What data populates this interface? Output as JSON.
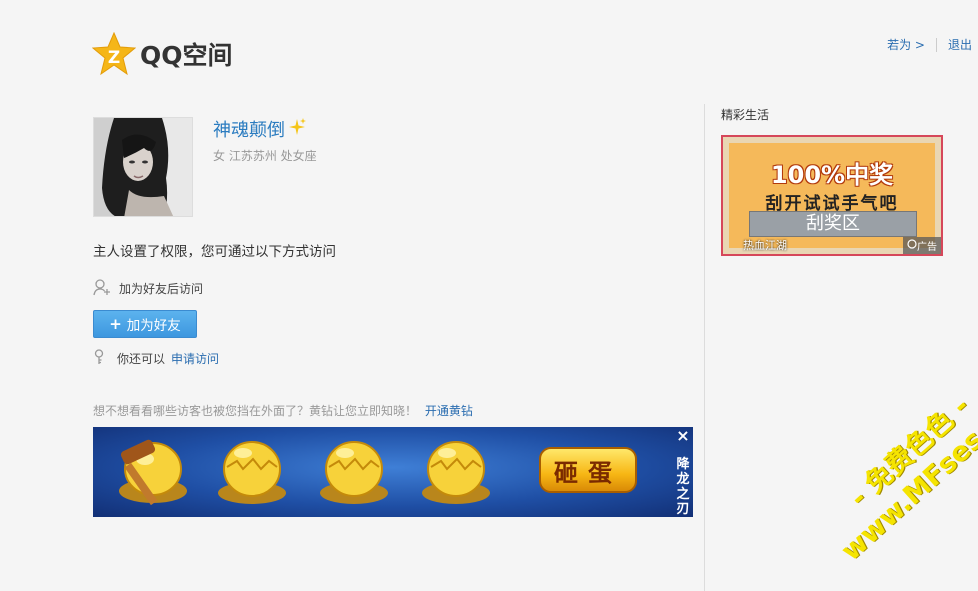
{
  "header": {
    "logo_text": "QQ空间",
    "user_link": "若为 >",
    "logout": "退出"
  },
  "profile": {
    "username": "神魂颠倒",
    "meta": "女 江苏苏州 处女座"
  },
  "permission": {
    "message": "主人设置了权限，您可通过以下方式访问",
    "friend_option": "加为好友后访问",
    "add_friend_button": "加为好友",
    "apply_prefix": "你还可以",
    "apply_link": "申请访问"
  },
  "vip": {
    "message": "想不想看看哪些访客也被您挡在外面了？黄钻让您立即知晓！",
    "link": "开通黄钻"
  },
  "banner": {
    "button_text": "砸蛋",
    "side_text": "降龙之刃",
    "close": "×"
  },
  "side": {
    "title": "精彩生活",
    "ad": {
      "headline": "100%中奖",
      "subline": "刮开试试手气吧",
      "scratch_area": "刮奖区",
      "brand": "热血江湖",
      "tag": "广告"
    }
  },
  "watermark": {
    "line1": "- 免费色色 -",
    "line2": "www.MFsese.com"
  },
  "colors": {
    "accent": "#2b7cc0",
    "button": "#3d97df",
    "background": "#f5f5f5"
  }
}
